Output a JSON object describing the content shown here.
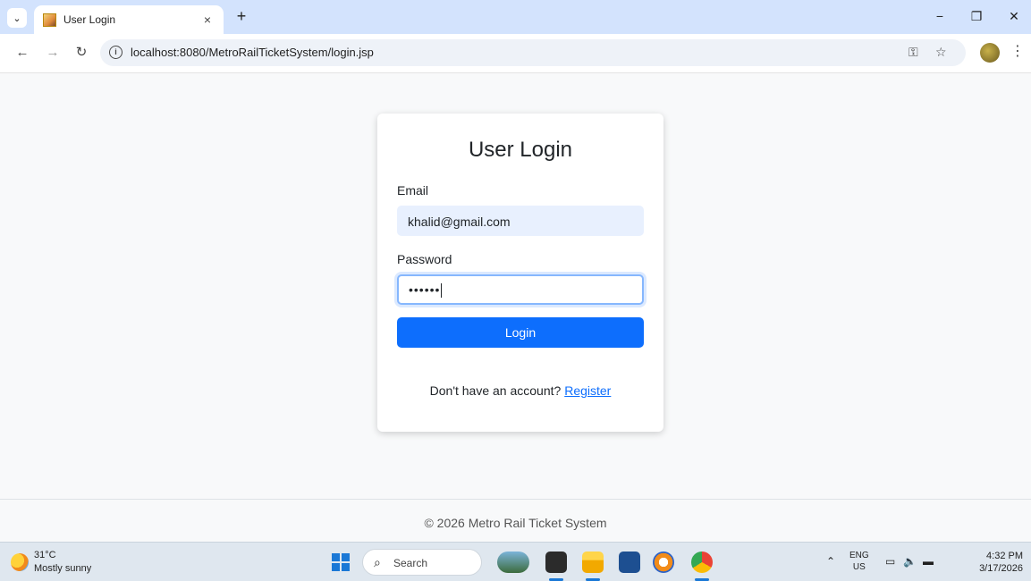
{
  "browser": {
    "tab_title": "User Login",
    "tab_close": "×",
    "new_tab": "+",
    "url": "localhost:8080/MetroRailTicketSystem/login.jsp",
    "window_controls": {
      "minimize": "−",
      "restore": "❐",
      "close": "✕"
    }
  },
  "login_form": {
    "title": "User Login",
    "email_label": "Email",
    "email_value": "khalid@gmail.com",
    "password_label": "Password",
    "password_masked": "••••••",
    "login_button": "Login",
    "register_prompt": "Don't have an account? ",
    "register_link": "Register"
  },
  "footer": {
    "text": "© 2026 Metro Rail Ticket System"
  },
  "taskbar": {
    "weather_temp": "31°C",
    "weather_desc": "Mostly sunny",
    "search_label": "Search",
    "lang_top": "ENG",
    "lang_bottom": "US",
    "time": "4:32 PM",
    "date": "3/17/2026"
  },
  "colors": {
    "primary": "#0d6efd",
    "focus_border": "#86b7fe",
    "autofill_bg": "#e8f0fe",
    "tabstrip": "#d3e3fd"
  }
}
